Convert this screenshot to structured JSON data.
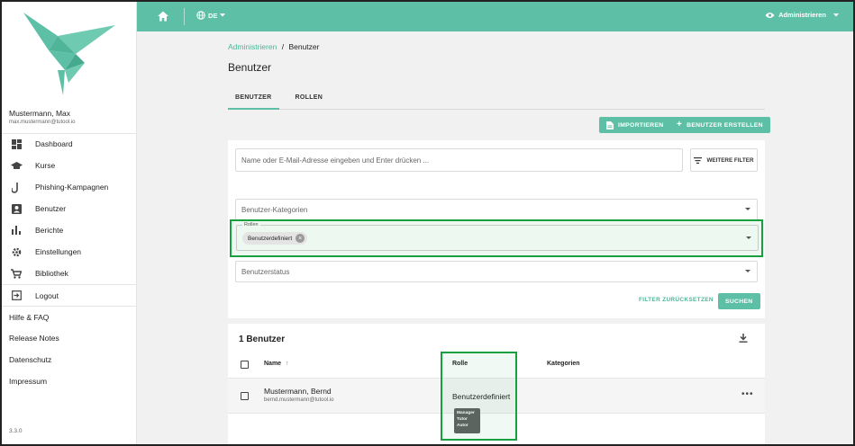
{
  "sidebar": {
    "user_name": "Mustermann, Max",
    "user_email": "max.mustermann@tutool.io",
    "items": [
      {
        "label": "Dashboard",
        "icon": "dashboard-icon"
      },
      {
        "label": "Kurse",
        "icon": "graduation-cap-icon"
      },
      {
        "label": "Phishing-Kampagnen",
        "icon": "phishing-hook-icon"
      },
      {
        "label": "Benutzer",
        "icon": "user-badge-icon"
      },
      {
        "label": "Berichte",
        "icon": "bar-chart-icon"
      },
      {
        "label": "Einstellungen",
        "icon": "gear-icon"
      },
      {
        "label": "Bibliothek",
        "icon": "cart-icon"
      },
      {
        "label": "Logout",
        "icon": "logout-icon"
      }
    ],
    "links": [
      "Hilfe & FAQ",
      "Release Notes",
      "Datenschutz",
      "Impressum"
    ],
    "version": "3.3.0"
  },
  "topbar": {
    "language": "DE",
    "role": "Administrieren"
  },
  "breadcrumb": {
    "parent": "Administrieren",
    "separator": "/",
    "current": "Benutzer"
  },
  "page_title": "Benutzer",
  "tabs": [
    "BENUTZER",
    "ROLLEN"
  ],
  "actions": {
    "import": "IMPORTIEREN",
    "create": "BENUTZER ERSTELLEN"
  },
  "filters": {
    "search_placeholder": "Name oder E-Mail-Adresse eingeben und Enter drücken ...",
    "more_filters": "WEITERE FILTER",
    "categories_placeholder": "Benutzer-Kategorien",
    "roles_label": "Rollen",
    "roles_selected": "Benutzerdefiniert",
    "status_placeholder": "Benutzerstatus",
    "reset": "FILTER ZURÜCKSETZEN",
    "search": "SUCHEN"
  },
  "results": {
    "count": "1 Benutzer",
    "columns": {
      "name": "Name",
      "role": "Rolle",
      "categories": "Kategorien"
    },
    "rows": [
      {
        "name": "Mustermann, Bernd",
        "email": "bernd.mustermann@tutool.io",
        "role": "Benutzerdefiniert",
        "role_details": [
          "Manager",
          "Tutor",
          "Autor"
        ]
      }
    ]
  },
  "colors": {
    "accent": "#5dc0a6",
    "highlight": "#17a03f"
  }
}
